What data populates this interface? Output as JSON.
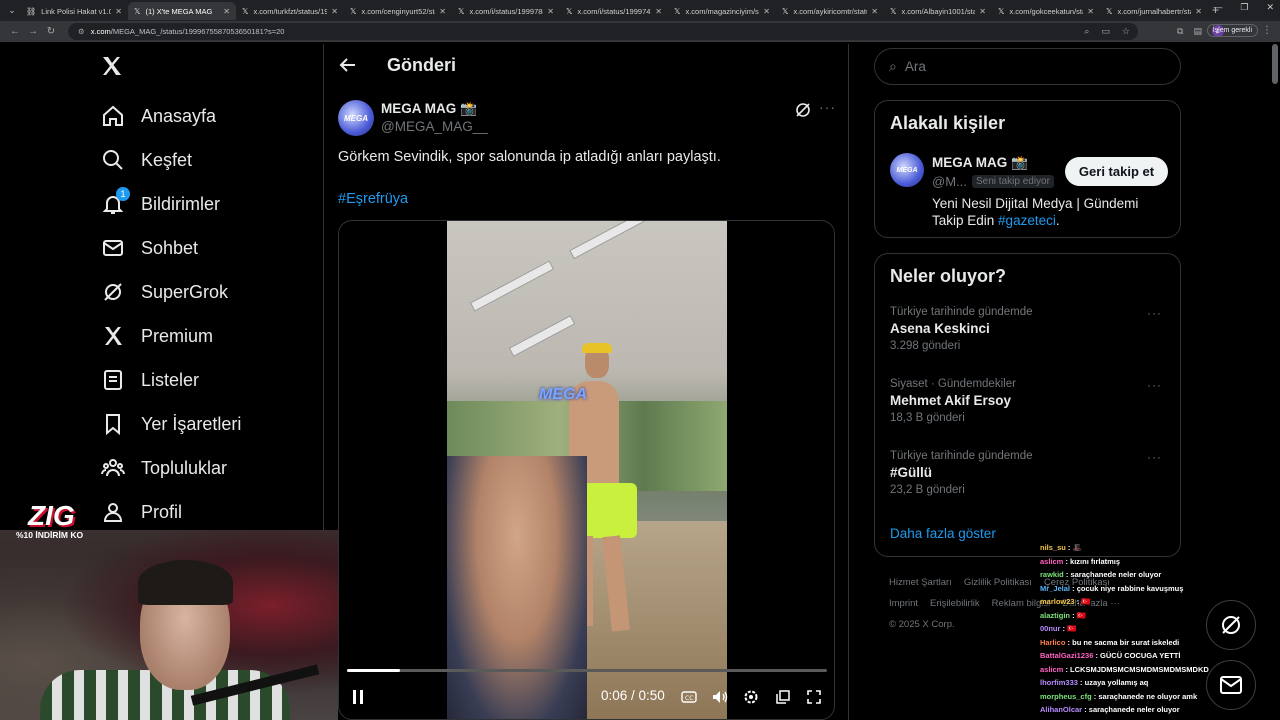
{
  "browser": {
    "tabs": [
      {
        "title": "Link Polisi Hakat v1.0",
        "icon": "link-icon"
      },
      {
        "title": "(1) X'te MEGA MAG",
        "icon": "x-icon",
        "active": true
      },
      {
        "title": "x.com/turkfzt/status/1999",
        "icon": "x-icon"
      },
      {
        "title": "x.com/cenginyurt52/statu",
        "icon": "x-icon"
      },
      {
        "title": "x.com/i/status/199978821",
        "icon": "x-icon"
      },
      {
        "title": "x.com/i/status/19997475",
        "icon": "x-icon"
      },
      {
        "title": "x.com/magazinciyim/stat",
        "icon": "x-icon"
      },
      {
        "title": "x.com/aykiricomtr/status",
        "icon": "x-icon"
      },
      {
        "title": "x.com/Albayin1001/stat",
        "icon": "x-icon"
      },
      {
        "title": "x.com/gokceekatun/statu",
        "icon": "x-icon"
      },
      {
        "title": "x.com/jurnalhabertr/statu",
        "icon": "x-icon"
      }
    ],
    "url_host": "x.com",
    "url_path": "/MEGA_MAG_/status/1999675587053650181?s=20",
    "update_label": "İşlem gerekli",
    "profile_initial": "c"
  },
  "nav": {
    "items": [
      {
        "label": "Anasayfa",
        "icon": "home-icon"
      },
      {
        "label": "Keşfet",
        "icon": "search-icon"
      },
      {
        "label": "Bildirimler",
        "icon": "bell-icon",
        "badge": "1"
      },
      {
        "label": "Sohbet",
        "icon": "mail-icon"
      },
      {
        "label": "SuperGrok",
        "icon": "grok-icon"
      },
      {
        "label": "Premium",
        "icon": "x-premium-icon"
      },
      {
        "label": "Listeler",
        "icon": "list-icon"
      },
      {
        "label": "Yer İşaretleri",
        "icon": "bookmark-icon"
      },
      {
        "label": "Topluluklar",
        "icon": "communities-icon"
      },
      {
        "label": "Profil",
        "icon": "profile-icon"
      }
    ]
  },
  "main": {
    "title": "Gönderi",
    "post": {
      "author_name": "MEGA MAG",
      "author_badge": "📸",
      "author_handle": "@MEGA_MAG__",
      "avatar_text": "MEGA",
      "text": "Görkem Sevindik, spor salonunda ip atladığı anları paylaştı.",
      "hashtag": "#Eşrefrüya",
      "video": {
        "watermark": "MEGA",
        "current_time": "0:06",
        "duration": "0:50",
        "time_display": "0:06 / 0:50",
        "progress": 0.11
      }
    }
  },
  "right": {
    "search_placeholder": "Ara",
    "related": {
      "title": "Alakalı kişiler",
      "name": "MEGA MAG 📸",
      "handle": "@M...",
      "follows_you": "Seni takip ediyor",
      "follow_label": "Geri takip et",
      "bio": "Yeni Nesil Dijital Medya | Gündemi Takip Edin ",
      "bio_link": "#gazeteci",
      "bio_end": "."
    },
    "trends": {
      "title": "Neler oluyor?",
      "items": [
        {
          "meta": "Türkiye tarihinde gündemde",
          "name": "Asena Keskinci",
          "count": "3.298 gönderi"
        },
        {
          "meta": "Siyaset · Gündemdekiler",
          "name": "Mehmet Akif Ersoy",
          "count": "18,3 B gönderi"
        },
        {
          "meta": "Türkiye tarihinde gündemde",
          "name": "#Güllü",
          "count": "23,2 B gönderi"
        }
      ],
      "show_more": "Daha fazla göster"
    },
    "footer": {
      "links": [
        "Hizmet Şartları",
        "Gizlilik Politikası",
        "Çerez Politikası",
        "Imprint",
        "Erişilebilirlik",
        "Reklam bilgisi",
        "Daha fazla ···",
        "© 2025 X Corp."
      ]
    }
  },
  "overlay": {
    "logo": "ZIG",
    "promo": "%10 İNDİRİM KO",
    "chat": [
      {
        "user": "nils_su",
        "text": "🎩",
        "cls": "u3"
      },
      {
        "user": "aslicm",
        "text": "kızını fırlatmış",
        "cls": "u1"
      },
      {
        "user": "rawkid",
        "text": "saraçhanede neler oluyor",
        "cls": "u2"
      },
      {
        "user": "Mr_Jelal",
        "text": "çocuk niye rabbine kavuşmuş",
        "cls": "u4"
      },
      {
        "user": "marlow23",
        "text": "🇹🇷",
        "cls": "u3"
      },
      {
        "user": "alaztigin",
        "text": "🇹🇷",
        "cls": "u2"
      },
      {
        "user": "00nur",
        "text": "🇹🇷",
        "cls": "u6"
      },
      {
        "user": "Harlico",
        "text": "bu ne sacma bir surat iskeledi",
        "cls": "u5"
      },
      {
        "user": "BattalGazi1236",
        "text": "GÜCÜ COCUGA YETTİ",
        "cls": "u1"
      },
      {
        "user": "aslicm",
        "text": "LCKSMJDMSMCMSMDMSMDMSMDKD",
        "cls": "u1"
      },
      {
        "user": "lhorfim333",
        "text": "uzaya yollamış aq",
        "cls": "u6"
      },
      {
        "user": "morpheus_cfg",
        "text": "saraçhanede ne oluyor amk",
        "cls": "u2"
      },
      {
        "user": "AlihanOlcar",
        "text": "saraçhanede neler oluyor",
        "cls": "u6"
      }
    ]
  }
}
